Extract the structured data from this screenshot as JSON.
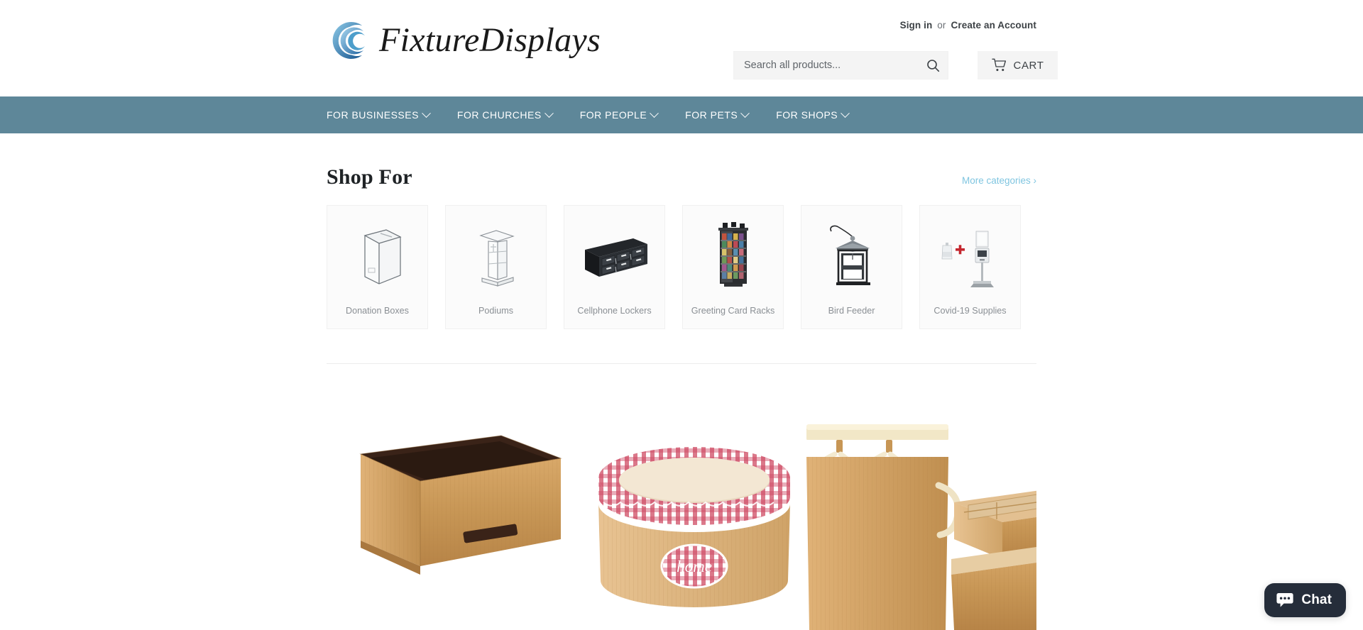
{
  "site": {
    "brand_name": "FixtureDisplays",
    "logo_icon": "swirl-wave-logo-icon",
    "nav_bar_color": "#5e8799",
    "link_accent_color": "#7fc5e0",
    "chat_button_color": "#252d3a"
  },
  "header": {
    "sign_in_label": "Sign in",
    "separator_label": "or",
    "create_account_label": "Create an Account",
    "search": {
      "placeholder": "Search all products...",
      "value": "",
      "icon": "search-icon"
    },
    "cart": {
      "label": "CART",
      "icon": "cart-icon"
    }
  },
  "nav": {
    "items": [
      {
        "label": "FOR BUSINESSES",
        "icon": "chevron-down-icon"
      },
      {
        "label": "FOR CHURCHES",
        "icon": "chevron-down-icon"
      },
      {
        "label": "FOR PEOPLE",
        "icon": "chevron-down-icon"
      },
      {
        "label": "FOR PETS",
        "icon": "chevron-down-icon"
      },
      {
        "label": "FOR SHOPS",
        "icon": "chevron-down-icon"
      }
    ]
  },
  "shop_for": {
    "title": "Shop For",
    "more_link_label": "More categories ›",
    "categories": [
      {
        "label": "Donation Boxes",
        "icon": "acrylic-donation-box-icon"
      },
      {
        "label": "Podiums",
        "icon": "podium-lectern-icon"
      },
      {
        "label": "Cellphone Lockers",
        "icon": "cellphone-locker-icon"
      },
      {
        "label": "Greeting Card Racks",
        "icon": "greeting-card-rack-icon"
      },
      {
        "label": "Bird Feeder",
        "icon": "bird-feeder-icon"
      },
      {
        "label": "Covid-19 Supplies",
        "icon": "sanitizer-stand-icon"
      }
    ]
  },
  "hero": {
    "alt": "Bamboo storage baskets and laundry hampers",
    "basket_label": "home"
  },
  "chat": {
    "label": "Chat",
    "icon": "chat-bubble-icon"
  }
}
